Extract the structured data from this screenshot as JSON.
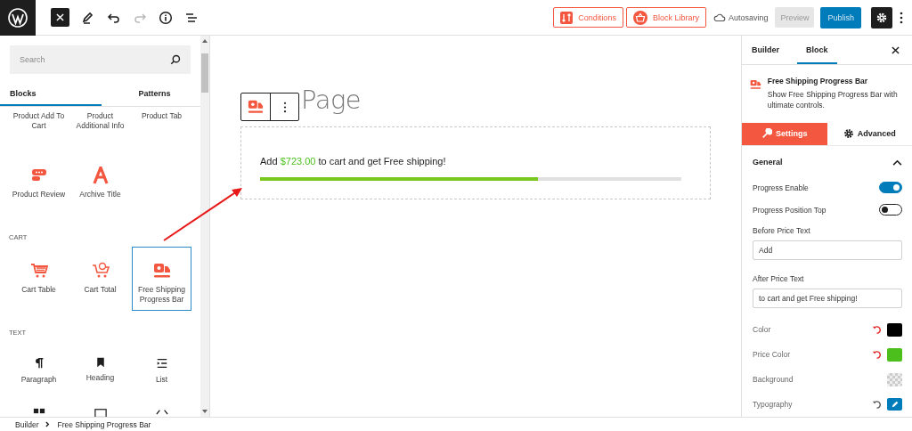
{
  "topbar": {
    "conditions": "Conditions",
    "block_library": "Block Library",
    "status": "Autosaving",
    "preview": "Preview",
    "publish": "Publish"
  },
  "inserter": {
    "search_placeholder": "Search",
    "tabs": [
      {
        "label": "Blocks",
        "selected": true
      },
      {
        "label": "Patterns",
        "selected": false
      }
    ],
    "sections": [
      {
        "items": [
          {
            "label": "Product Add To Cart",
            "selected": false
          },
          {
            "label": "Product Additional Info",
            "selected": false
          },
          {
            "label": "Product Tab",
            "selected": false
          },
          {
            "label": "Product Review",
            "selected": false
          },
          {
            "label": "Archive Title",
            "selected": false
          }
        ]
      },
      {
        "heading": "CART",
        "items": [
          {
            "label": "Cart Table",
            "selected": false
          },
          {
            "label": "Cart Total",
            "selected": false
          },
          {
            "label": "Free Shipping Progress Bar",
            "selected": true
          }
        ]
      },
      {
        "heading": "TEXT",
        "items": [
          {
            "label": "Paragraph",
            "selected": false
          },
          {
            "label": "Heading",
            "selected": false
          },
          {
            "label": "List",
            "selected": false
          }
        ]
      }
    ]
  },
  "canvas": {
    "page_title": "Page",
    "notice": {
      "before": "Add",
      "price": "$723.00",
      "after": "to cart and get Free shipping!"
    },
    "level": 0.66
  },
  "panel": {
    "tabs": [
      {
        "label": "Builder",
        "selected": false
      },
      {
        "label": "Block",
        "selected": true
      }
    ],
    "block": {
      "title": "Free Shipping Progress Bar",
      "description": "Show Free Shipping Progress Bar with ultimate controls."
    },
    "subtabs": [
      {
        "label": "Settings",
        "selected": true
      },
      {
        "label": "Advanced",
        "selected": false
      }
    ],
    "section": {
      "title": "General",
      "expanded": true
    },
    "fields": [
      {
        "kind": "toggle",
        "label": "Progress Enable",
        "on": true
      },
      {
        "kind": "toggle",
        "label": "Progress Position Top",
        "on": false
      },
      {
        "kind": "text",
        "label": "Before Price Text",
        "value": "Add"
      },
      {
        "kind": "text",
        "label": "After Price Text",
        "value": "to cart and get Free shipping!"
      },
      {
        "kind": "color",
        "label": "Color",
        "color": "#000000",
        "modified": true
      },
      {
        "kind": "color",
        "label": "Price Color",
        "color": "#4cbf1c",
        "modified": true
      },
      {
        "kind": "color",
        "label": "Background"
      },
      {
        "kind": "typography",
        "label": "Typography",
        "modified": false
      }
    ]
  },
  "breadcrumb": [
    "Builder",
    "Free Shipping Progress Bar"
  ]
}
